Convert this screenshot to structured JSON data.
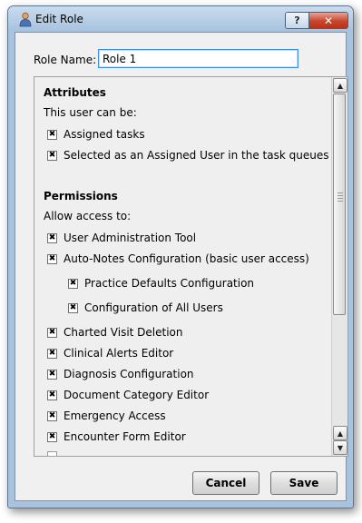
{
  "window": {
    "title": "Edit Role",
    "help_glyph": "?",
    "close_glyph": "✕"
  },
  "role_name": {
    "label": "Role Name:",
    "value": "Role 1"
  },
  "attributes": {
    "heading": "Attributes",
    "subtext": "This user can be:",
    "items": [
      {
        "label": "Assigned tasks",
        "checked": true
      },
      {
        "label": "Selected as an Assigned User in the task queues",
        "checked": true
      }
    ]
  },
  "permissions": {
    "heading": "Permissions",
    "subtext": "Allow access to:",
    "items": [
      {
        "label": "User Administration Tool",
        "checked": true
      },
      {
        "label": "Auto-Notes Configuration (basic user access)",
        "checked": true
      },
      {
        "label": "Practice Defaults Configuration",
        "checked": true
      },
      {
        "label": "Configuration of All Users",
        "checked": true
      },
      {
        "label": "Charted Visit Deletion",
        "checked": true
      },
      {
        "label": "Clinical Alerts Editor",
        "checked": true
      },
      {
        "label": "Diagnosis Configuration",
        "checked": true
      },
      {
        "label": "Document Category Editor",
        "checked": true
      },
      {
        "label": "Emergency Access",
        "checked": true
      },
      {
        "label": "Encounter Form Editor",
        "checked": true
      }
    ]
  },
  "buttons": {
    "cancel": "Cancel",
    "save": "Save"
  }
}
